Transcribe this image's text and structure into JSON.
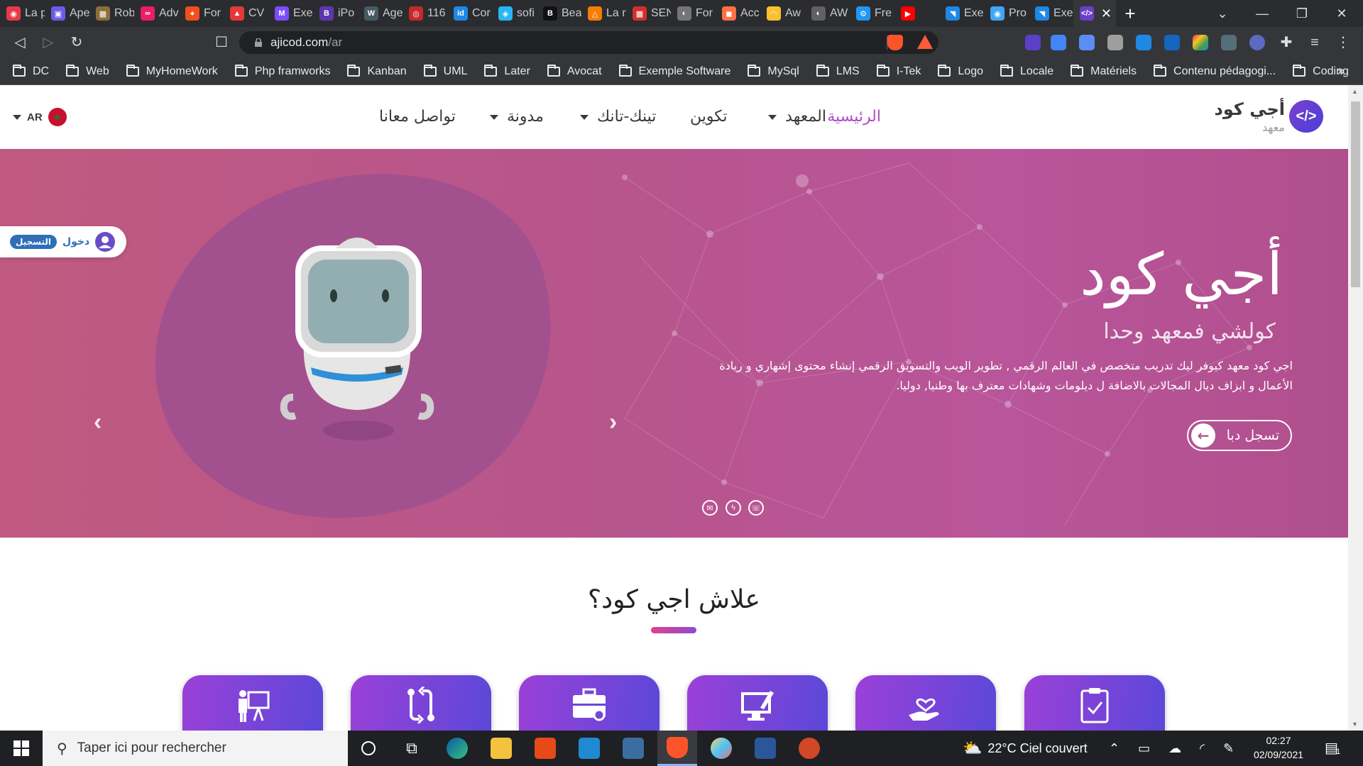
{
  "browser": {
    "tabs": [
      {
        "title": "La p",
        "color": "#e63946",
        "glyph": "◉"
      },
      {
        "title": "Ape",
        "color": "#6c5ce7",
        "glyph": "▣"
      },
      {
        "title": "Rob",
        "color": "#8d6e3a",
        "glyph": "▦"
      },
      {
        "title": "Adv",
        "color": "#e91e63",
        "glyph": "∞"
      },
      {
        "title": "For",
        "color": "#f24e1e",
        "glyph": "✦"
      },
      {
        "title": "CV",
        "color": "#e53935",
        "glyph": "▲"
      },
      {
        "title": "Exe",
        "color": "#7c4dff",
        "glyph": "M"
      },
      {
        "title": "iPo",
        "color": "#5e35b1",
        "glyph": "B"
      },
      {
        "title": "Age",
        "color": "#455a64",
        "glyph": "W"
      },
      {
        "title": "116",
        "color": "#c62828",
        "glyph": "◎"
      },
      {
        "title": "Cor",
        "color": "#1e88e5",
        "glyph": "id"
      },
      {
        "title": "sofi",
        "color": "#29b6f6",
        "glyph": "◈"
      },
      {
        "title": "Bea",
        "color": "#111111",
        "glyph": "B"
      },
      {
        "title": "La r",
        "color": "#f57c00",
        "glyph": "△"
      },
      {
        "title": "SEN",
        "color": "#d32f2f",
        "glyph": "▩"
      },
      {
        "title": "For",
        "color": "#757575",
        "glyph": "◐"
      },
      {
        "title": "Acc",
        "color": "#ff7043",
        "glyph": "◼"
      },
      {
        "title": "Aw",
        "color": "#fbc02d",
        "glyph": "◠"
      },
      {
        "title": "AW",
        "color": "#616161",
        "glyph": "◐"
      },
      {
        "title": "Fre",
        "color": "#2196f3",
        "glyph": "⚙"
      },
      {
        "title": "",
        "color": "#ff0000",
        "glyph": "▶"
      },
      {
        "title": "Exe",
        "color": "#1e88e5",
        "glyph": "◥"
      },
      {
        "title": "Pro",
        "color": "#42a5f5",
        "glyph": "◉"
      },
      {
        "title": "Exe",
        "color": "#1e88e5",
        "glyph": "◥"
      },
      {
        "title": "",
        "color": "#6a3fc7",
        "glyph": "</>",
        "active": true
      }
    ],
    "url_host": "ajicod.com",
    "url_path": "/ar",
    "bookmarks": [
      "DC",
      "Web",
      "MyHomeWork",
      "Php framworks",
      "Kanban",
      "UML",
      "Later",
      "Avocat",
      "Exemple Software",
      "MySql",
      "LMS",
      "I-Tek",
      "Logo",
      "Locale",
      "Matériels",
      "Contenu pédagogi...",
      "Coding"
    ],
    "bookmarks_more": "»",
    "extension_badges": {
      "brave_shield": "1",
      "brave_rewards": "1",
      "ext_count_a": "6",
      "ext_count_b": "1"
    }
  },
  "site": {
    "logo_title": "أجي كود",
    "logo_sub": "معهد",
    "logo_badge": "</>",
    "nav": [
      {
        "label": "الرئيسية",
        "active": true,
        "dropdown": false
      },
      {
        "label": "المعهد",
        "active": false,
        "dropdown": true
      },
      {
        "label": "تكوين",
        "active": false,
        "dropdown": false
      },
      {
        "label": "تينك-تانك",
        "active": false,
        "dropdown": true
      },
      {
        "label": "مدونة",
        "active": false,
        "dropdown": true
      },
      {
        "label": "تواصل معانا",
        "active": false,
        "dropdown": false
      }
    ],
    "lang": "AR",
    "login": {
      "login_label": "دخول",
      "signup_label": "التسجيل"
    },
    "hero": {
      "title": "أجي كود",
      "subtitle": "كولشي فمعهد وحدا",
      "description": "اجي كود معهد كيوفر ليك تدريب متخصص في العالم الرقمي , تطوير الويب والتسويق الرقمي إنشاء محتوى إشهاري و ريادة الأعمال و ابزاف ديال المجالات بالاضافة ل ديلومات وشهادات معترف بها وطنيا, دوليا.",
      "cta_label": "تسجل دبا",
      "slides": 4,
      "active_slide": 4
    },
    "why": {
      "title": "علاش اجي كود؟",
      "features": [
        "presentation-icon",
        "exchange-icon",
        "briefcase-icon",
        "computer-design-icon",
        "care-hand-icon",
        "clipboard-check-icon"
      ]
    }
  },
  "taskbar": {
    "search_placeholder": "Taper ici pour rechercher",
    "weather": "22°C  Ciel couvert",
    "time": "02:27",
    "date": "02/09/2021",
    "notifications": "1"
  }
}
